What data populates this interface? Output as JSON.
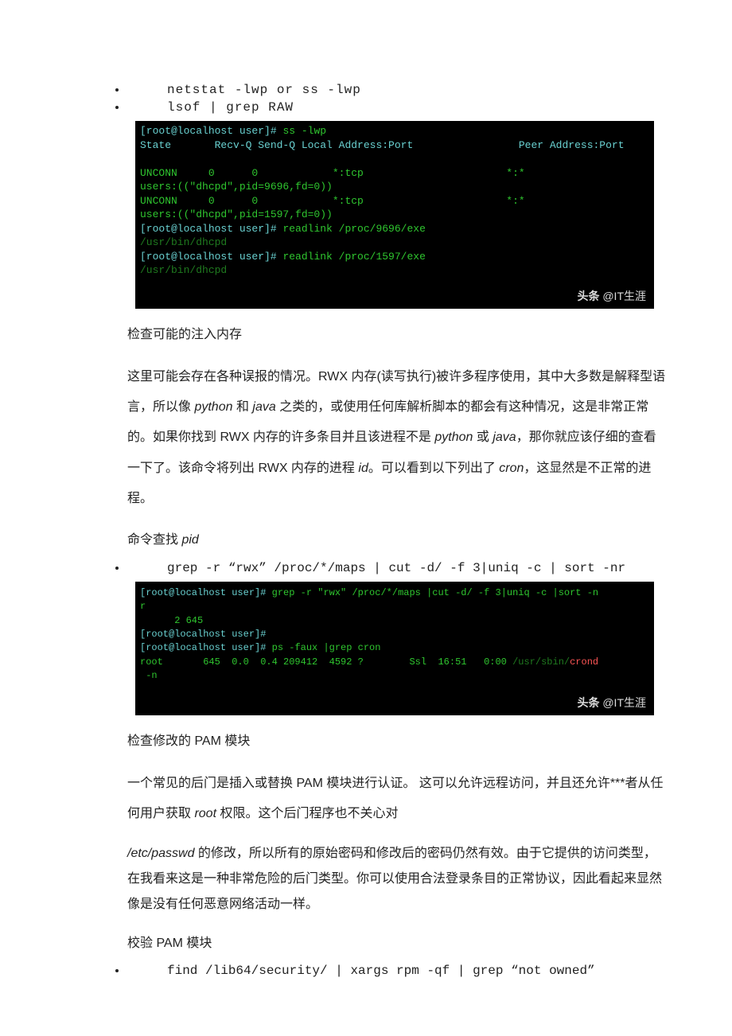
{
  "bullets_a": {
    "line1": "netstat -lwp or ss -lwp",
    "line2": "lsof | grep RAW"
  },
  "terminal_a": {
    "l1_prompt": "[root@localhost user]# ",
    "l1_cmd": "ss -lwp",
    "l2": "State       Recv-Q Send-Q Local Address:Port                 Peer Address:Port",
    "blank": "",
    "l3": "UNCONN     0      0            *:tcp                       *:*",
    "l4": "users:((\"dhcpd\",pid=9696,fd=0))",
    "l5": "UNCONN     0      0            *:tcp                       *:*",
    "l6": "users:((\"dhcpd\",pid=1597,fd=0))",
    "l7_prompt": "[root@localhost user]# ",
    "l7_cmd": "readlink /proc/9696/exe",
    "l8": "/usr/bin/dhcpd",
    "l9_prompt": "[root@localhost user]# ",
    "l9_cmd": "readlink /proc/1597/exe",
    "l10": "/usr/bin/dhcpd",
    "wm_bold": "头条",
    "wm_rest": " @IT生涯"
  },
  "paragraphs": {
    "p1a": "检查可能的注入内存",
    "p1b": "这里可能会存在各种误报的情况。RWX 内存(读写执行)被许多程序使用，其中大多数是解释型语言，所以像 ",
    "p1b_py": "python",
    "p1b_mid": " 和 ",
    "p1b_java": "java",
    "p1b_tail": " 之类的，或使用任何库解析脚本的都会有这种情况，这是非常正常的。如果你找到 RWX 内存的许多条目并且该进程不是 ",
    "p1c_py": "python",
    "p1c_mid": " 或 ",
    "p1c_java": "java",
    "p1c_tail": "，那你就应该仔细的查看一下了。该命令将列出 RWX 内存的进程 ",
    "p1c_id": "id",
    "p1c_end": "。可以看到以下列出了 ",
    "p1c_cron": "cron",
    "p1c_final": "，这显然是不正常的进程。",
    "p2a": "命令查找 ",
    "p2a_pid": "pid"
  },
  "bullets_b": {
    "line1": "grep -r “rwx” /proc/*/maps | cut -d/ -f 3|uniq -c | sort -nr"
  },
  "terminal_b": {
    "l1a": "[root@localhost user]# ",
    "l1b": "grep -r \"rwx\" /proc/*/maps |cut -d/ -f 3|uniq -c |sort -n",
    "l1c": "r",
    "l2": "      2 645",
    "l3a": "[root@localhost user]#",
    "l4a": "[root@localhost user]# ",
    "l4b": "ps -faux |grep cron",
    "l5a": "root       645  0.0  0.4 209412  4592 ?        Ssl  16:51   0:00 ",
    "l5b": "/usr/sbin/",
    "l5c": "crond",
    "l6": " -n",
    "wm_bold": "头条",
    "wm_rest": " @IT生涯"
  },
  "paragraphs2": {
    "p3a": "检查修改的 PAM 模块",
    "p3b": "一个常见的后门是插入或替换 PAM 模块进行认证。 这可以允许远程访问，并且还允许***者从任何用户获取 ",
    "p3b_root": "root",
    "p3b_tail": " 权限。这个后门程序也不关心对 ",
    "p3c_path": "/etc/passwd",
    "p3c_tail": " 的修改，所以所有的原始密码和修改后的密码仍然有效。由于它提供的访问类型，在我看来这是一种非常危险的后门类型。你可以使用合法登录条目的正常协议，因此看起来显然像是没有任何恶意网络活动一样。",
    "p4a": "校验 PAM 模块"
  },
  "bullets_c": {
    "line1": "find /lib64/security/ | xargs rpm -qf | grep “not owned”"
  }
}
